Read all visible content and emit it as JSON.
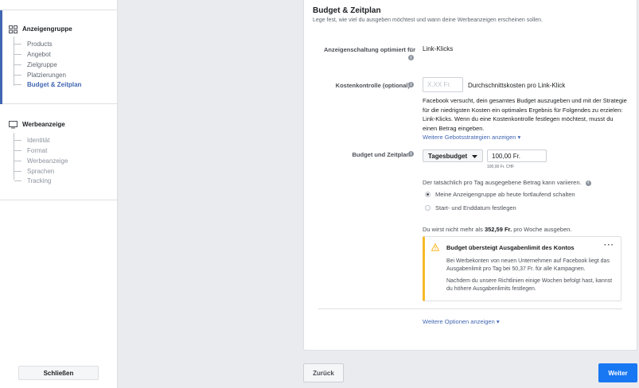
{
  "sidebar": {
    "adset": {
      "title": "Anzeigengruppe",
      "icon": "grid-icon",
      "items": [
        {
          "label": "Products"
        },
        {
          "label": "Angebot"
        },
        {
          "label": "Zielgruppe"
        },
        {
          "label": "Platzierungen"
        },
        {
          "label": "Budget & Zeitplan",
          "active": true
        }
      ]
    },
    "ad": {
      "title": "Werbeanzeige",
      "icon": "monitor-icon",
      "items": [
        {
          "label": "Identität"
        },
        {
          "label": "Format"
        },
        {
          "label": "Werbeanzeige"
        },
        {
          "label": "Sprachen"
        },
        {
          "label": "Tracking"
        }
      ]
    },
    "close_label": "Schließen"
  },
  "section": {
    "title": "Budget & Zeitplan",
    "subtitle": "Lege fest, wie viel du ausgeben möchtest und wann deine Werbeanzeigen erscheinen sollen."
  },
  "optimization": {
    "label": "Anzeigenschaltung optimiert für",
    "value": "Link-Klicks"
  },
  "cost_control": {
    "label": "Kostenkontrolle (optional)",
    "placeholder": "X.XX Fr.",
    "suffix": "Durchschnittskosten pro Link-Klick",
    "description": "Facebook versucht, dein gesamtes Budget auszugeben und mit der Strategie für die niedrigsten Kosten ein optimales Ergebnis für Folgendes zu erzielen: Link-Klicks. Wenn du eine Kostenkontrolle festlegen möchtest, musst du einen Betrag eingeben.",
    "more_link": "Weitere Gebotsstrategien anzeigen ▾"
  },
  "budget": {
    "label": "Budget und Zeitplan",
    "type": "Tagesbudget",
    "amount": "100,00 Fr.",
    "amount_hint": "100,00 Fr. CHF",
    "variance_note": "Der tatsächlich pro Tag ausgegebene Betrag kann variieren.",
    "options": [
      {
        "label": "Meine Anzeigengruppe ab heute fortlaufend schalten",
        "checked": true
      },
      {
        "label": "Start- und Enddatum festlegen",
        "checked": false
      }
    ],
    "weekly_prefix": "Du wirst nicht mehr als",
    "weekly_amount": "352,59 Fr.",
    "weekly_suffix": "pro Woche ausgeben."
  },
  "warning": {
    "title": "Budget übersteigt Ausgabenlimit des Kontos",
    "more": "···",
    "para1": "Bei Werbekonten von neuen Unternehmen auf Facebook liegt das Ausgabenlimit pro Tag bei 50,37 Fr. für alle Kampagnen.",
    "para2": "Nachdem du unsere Richtlinien einige Wochen befolgt hast, kannst du höhere Ausgabenlimits festlegen.",
    "color": "#f7b928"
  },
  "more_options": "Weitere Optionen anzeigen ▾",
  "footer": {
    "back_label": "Zurück",
    "next_label": "Weiter"
  },
  "colors": {
    "accent": "#4267b2",
    "primary_button": "#1877f2"
  }
}
